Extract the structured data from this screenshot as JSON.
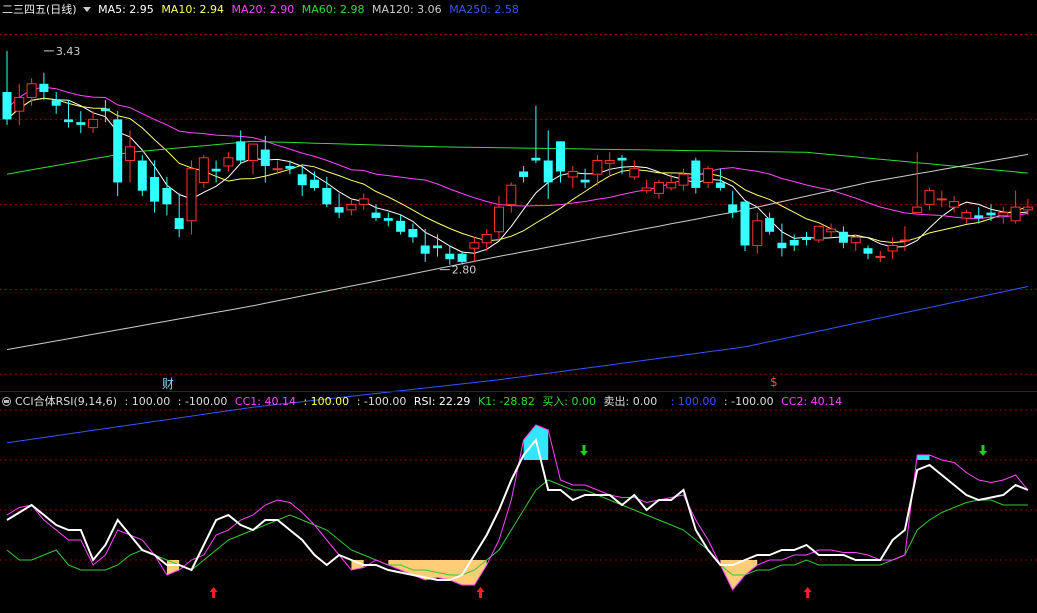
{
  "main_header": {
    "stock_name": "二三四五",
    "period": "(日线)",
    "indicators": [
      {
        "label": "MA5: 2.95",
        "color": "#ffffff"
      },
      {
        "label": "MA10: 2.94",
        "color": "#ffff66"
      },
      {
        "label": "MA20: 2.90",
        "color": "#ff44ff"
      },
      {
        "label": "MA60: 2.98",
        "color": "#33dd33"
      },
      {
        "label": "MA120: 3.06",
        "color": "#cccccc"
      },
      {
        "label": "MA250: 2.58",
        "color": "#3355ff"
      }
    ]
  },
  "sub_header": {
    "indicator_name": "CCI合体RSI(9,14,6)",
    "values": [
      {
        "label": ": 100.00",
        "color": "#dddddd"
      },
      {
        "label": ": -100.00",
        "color": "#dddddd"
      },
      {
        "label": "CC1: 40.14",
        "color": "#ff44ff"
      },
      {
        "label": ": 100.00",
        "color": "#ffff66"
      },
      {
        "label": ": -100.00",
        "color": "#dddddd"
      },
      {
        "label": "RSI: 22.29",
        "color": "#ffffff"
      },
      {
        "label": "K1: -28.82",
        "color": "#33dd33"
      },
      {
        "label": "买入: 0.00",
        "color": "#33dd33"
      },
      {
        "label": "卖出: 0.00",
        "color": "#dddddd"
      },
      {
        "label": ": 100.00",
        "color": "#3355ff"
      },
      {
        "label": ": -100.00",
        "color": "#dddddd"
      },
      {
        "label": "CC2: 40.14",
        "color": "#ff44ff"
      }
    ]
  },
  "annotations": {
    "high_label": "3.43",
    "low_label": "2.80",
    "cai_marker": "财",
    "dollar_marker": "$"
  },
  "colors": {
    "up": "#ff3333",
    "down": "#33ffff",
    "grid": "#8b0000",
    "fill_high": "#33e6ff",
    "fill_low": "#ffcc77",
    "buy_arrow": "#ff2222",
    "sell_arrow": "#22cc22"
  },
  "chart_data": {
    "type": "candlestick",
    "price_ylim": [
      2.2,
      3.55
    ],
    "candles": [
      [
        3.28,
        3.43,
        3.16,
        3.18
      ],
      [
        3.21,
        3.31,
        3.16,
        3.26
      ],
      [
        3.26,
        3.33,
        3.23,
        3.31
      ],
      [
        3.31,
        3.35,
        3.25,
        3.28
      ],
      [
        3.25,
        3.28,
        3.2,
        3.23
      ],
      [
        3.18,
        3.25,
        3.15,
        3.17
      ],
      [
        3.17,
        3.21,
        3.13,
        3.16
      ],
      [
        3.15,
        3.21,
        3.13,
        3.18
      ],
      [
        3.22,
        3.25,
        3.17,
        3.21
      ],
      [
        3.18,
        3.21,
        2.9,
        2.95
      ],
      [
        3.03,
        3.14,
        2.95,
        3.08
      ],
      [
        3.03,
        3.05,
        2.9,
        2.92
      ],
      [
        2.97,
        3.03,
        2.84,
        2.88
      ],
      [
        2.93,
        2.97,
        2.83,
        2.87
      ],
      [
        2.82,
        2.91,
        2.75,
        2.78
      ],
      [
        2.81,
        3.03,
        2.76,
        3.0
      ],
      [
        2.95,
        3.05,
        2.93,
        3.04
      ],
      [
        3.0,
        3.03,
        2.95,
        2.99
      ],
      [
        3.01,
        3.06,
        2.99,
        3.04
      ],
      [
        3.1,
        3.14,
        3.02,
        3.03
      ],
      [
        3.03,
        3.09,
        2.98,
        3.09
      ],
      [
        3.07,
        3.12,
        2.95,
        3.01
      ],
      [
        3.0,
        3.03,
        2.98,
        3.0
      ],
      [
        3.01,
        3.03,
        2.98,
        3.0
      ],
      [
        2.98,
        3.01,
        2.9,
        2.94
      ],
      [
        2.96,
        2.99,
        2.92,
        2.93
      ],
      [
        2.93,
        2.97,
        2.86,
        2.87
      ],
      [
        2.86,
        2.91,
        2.82,
        2.84
      ],
      [
        2.85,
        2.89,
        2.83,
        2.87
      ],
      [
        2.87,
        2.91,
        2.85,
        2.89
      ],
      [
        2.84,
        2.87,
        2.81,
        2.82
      ],
      [
        2.82,
        2.84,
        2.79,
        2.81
      ],
      [
        2.81,
        2.83,
        2.76,
        2.77
      ],
      [
        2.78,
        2.8,
        2.73,
        2.75
      ],
      [
        2.72,
        2.78,
        2.66,
        2.69
      ],
      [
        2.72,
        2.76,
        2.68,
        2.71
      ],
      [
        2.69,
        2.72,
        2.65,
        2.67
      ],
      [
        2.69,
        2.7,
        2.65,
        2.66
      ],
      [
        2.71,
        2.75,
        2.66,
        2.73
      ],
      [
        2.73,
        2.78,
        2.7,
        2.76
      ],
      [
        2.77,
        2.9,
        2.74,
        2.86
      ],
      [
        2.87,
        2.95,
        2.84,
        2.94
      ],
      [
        2.99,
        3.01,
        2.95,
        2.97
      ],
      [
        3.04,
        3.23,
        3.02,
        3.03
      ],
      [
        3.03,
        3.14,
        2.89,
        2.95
      ],
      [
        3.1,
        3.1,
        2.95,
        2.99
      ],
      [
        2.97,
        3.01,
        2.93,
        2.99
      ],
      [
        2.96,
        3.0,
        2.93,
        2.95
      ],
      [
        2.98,
        3.05,
        2.94,
        3.03
      ],
      [
        3.02,
        3.06,
        2.97,
        3.03
      ],
      [
        3.04,
        3.05,
        2.98,
        3.03
      ],
      [
        2.97,
        3.03,
        2.96,
        3.0
      ],
      [
        2.92,
        2.96,
        2.91,
        2.93
      ],
      [
        2.91,
        2.96,
        2.89,
        2.95
      ],
      [
        2.93,
        2.98,
        2.92,
        2.95
      ],
      [
        2.94,
        3.0,
        2.92,
        2.98
      ],
      [
        3.03,
        3.04,
        2.91,
        2.93
      ],
      [
        2.95,
        3.01,
        2.93,
        3.0
      ],
      [
        2.95,
        3.0,
        2.92,
        2.93
      ],
      [
        2.87,
        2.92,
        2.82,
        2.84
      ],
      [
        2.88,
        2.88,
        2.7,
        2.72
      ],
      [
        2.72,
        2.84,
        2.69,
        2.81
      ],
      [
        2.82,
        2.84,
        2.76,
        2.77
      ],
      [
        2.73,
        2.8,
        2.68,
        2.71
      ],
      [
        2.74,
        2.76,
        2.7,
        2.72
      ],
      [
        2.75,
        2.77,
        2.72,
        2.74
      ],
      [
        2.74,
        2.79,
        2.73,
        2.79
      ],
      [
        2.77,
        2.8,
        2.75,
        2.78
      ],
      [
        2.77,
        2.79,
        2.71,
        2.73
      ],
      [
        2.73,
        2.76,
        2.7,
        2.75
      ],
      [
        2.71,
        2.72,
        2.67,
        2.69
      ],
      [
        2.68,
        2.7,
        2.66,
        2.68
      ],
      [
        2.7,
        2.75,
        2.67,
        2.72
      ],
      [
        2.74,
        2.79,
        2.7,
        2.74
      ],
      [
        2.84,
        3.06,
        2.84,
        2.86
      ],
      [
        2.87,
        2.93,
        2.85,
        2.92
      ],
      [
        2.89,
        2.92,
        2.86,
        2.89
      ],
      [
        2.86,
        2.9,
        2.84,
        2.88
      ],
      [
        2.82,
        2.85,
        2.8,
        2.84
      ],
      [
        2.83,
        2.86,
        2.8,
        2.82
      ],
      [
        2.84,
        2.87,
        2.81,
        2.83
      ],
      [
        2.83,
        2.86,
        2.8,
        2.84
      ],
      [
        2.81,
        2.92,
        2.8,
        2.86
      ],
      [
        2.85,
        2.89,
        2.83,
        2.86
      ]
    ],
    "ma_series": [
      {
        "name": "MA5",
        "color": "#ffffff"
      },
      {
        "name": "MA10",
        "color": "#ffff66"
      },
      {
        "name": "MA20",
        "color": "#ff44ff"
      },
      {
        "name": "MA60",
        "color": "#33dd33"
      },
      {
        "name": "MA120",
        "color": "#cccccc"
      },
      {
        "name": "MA250",
        "color": "#3355ff"
      }
    ],
    "ma_anchor": {
      "MA60": [
        [
          0,
          2.98
        ],
        [
          10,
          3.06
        ],
        [
          20,
          3.1
        ],
        [
          35,
          3.08
        ],
        [
          50,
          3.07
        ],
        [
          65,
          3.06
        ],
        [
          84,
          2.98
        ]
      ],
      "MA120": [
        [
          0,
          2.34
        ],
        [
          20,
          2.5
        ],
        [
          40,
          2.68
        ],
        [
          60,
          2.85
        ],
        [
          70,
          2.95
        ],
        [
          84,
          3.06
        ]
      ],
      "MA250": [
        [
          0,
          2.0
        ],
        [
          20,
          2.13
        ],
        [
          40,
          2.23
        ],
        [
          60,
          2.35
        ],
        [
          84,
          2.58
        ]
      ]
    },
    "sub_ylim": [
      -200,
      200
    ],
    "cci": [
      -10,
      5,
      10,
      -20,
      -40,
      -60,
      -60,
      -110,
      -90,
      -40,
      -50,
      -60,
      -90,
      -130,
      -120,
      -100,
      -90,
      -50,
      -40,
      -20,
      -10,
      10,
      20,
      15,
      -5,
      -30,
      -60,
      -90,
      -120,
      -115,
      -100,
      -110,
      -120,
      -130,
      -140,
      -135,
      -140,
      -150,
      -150,
      -110,
      -60,
      20,
      140,
      170,
      160,
      60,
      50,
      50,
      40,
      30,
      25,
      25,
      15,
      20,
      25,
      30,
      -20,
      -60,
      -110,
      -160,
      -130,
      -110,
      -100,
      -100,
      -90,
      -90,
      -80,
      -80,
      -85,
      -85,
      -90,
      -100,
      -100,
      -90,
      110,
      110,
      100,
      95,
      75,
      60,
      55,
      60,
      70,
      40
    ],
    "rsi": [
      -20,
      -5,
      10,
      -10,
      -30,
      -40,
      -40,
      -100,
      -70,
      -20,
      -50,
      -80,
      -90,
      -110,
      -110,
      -120,
      -70,
      -20,
      -10,
      -30,
      -40,
      -20,
      -20,
      -40,
      -60,
      -90,
      -110,
      -90,
      -100,
      -110,
      -110,
      -120,
      -125,
      -130,
      -135,
      -140,
      -140,
      -130,
      -90,
      -50,
      0,
      60,
      110,
      140,
      40,
      40,
      20,
      30,
      30,
      30,
      10,
      30,
      0,
      20,
      20,
      40,
      -40,
      -80,
      -110,
      -110,
      -100,
      -90,
      -90,
      -80,
      -80,
      -70,
      -90,
      -90,
      -90,
      -100,
      -100,
      -100,
      -60,
      -40,
      80,
      90,
      70,
      50,
      30,
      20,
      25,
      30,
      50,
      40
    ],
    "k1": [
      -80,
      -100,
      -100,
      -90,
      -80,
      -110,
      -120,
      -120,
      -120,
      -110,
      -90,
      -80,
      -90,
      -100,
      -110,
      -120,
      -100,
      -80,
      -60,
      -50,
      -40,
      -30,
      -20,
      -10,
      -20,
      -30,
      -40,
      -60,
      -80,
      -90,
      -100,
      -110,
      -110,
      -120,
      -120,
      -125,
      -130,
      -130,
      -120,
      -100,
      -80,
      -40,
      0,
      40,
      60,
      50,
      40,
      40,
      30,
      20,
      10,
      0,
      -10,
      -20,
      -30,
      -40,
      -60,
      -80,
      -110,
      -130,
      -130,
      -120,
      -120,
      -110,
      -110,
      -100,
      -110,
      -110,
      -110,
      -110,
      -110,
      -110,
      -100,
      -90,
      -40,
      -20,
      -5,
      5,
      15,
      20,
      20,
      10,
      10,
      10
    ],
    "buy_arrows": [
      24,
      55,
      93
    ],
    "sell_arrows": [
      65,
      118
    ]
  }
}
